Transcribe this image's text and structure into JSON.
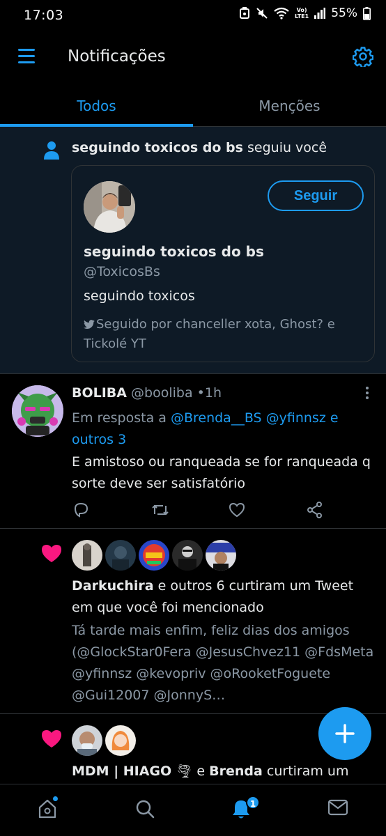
{
  "status_bar": {
    "time": "17:03",
    "network_label_top": "Vo)",
    "network_label_bottom": "LTE1",
    "battery": "55%"
  },
  "header": {
    "title": "Notificações",
    "menu_icon": "hamburger-icon",
    "settings_icon": "gear-icon"
  },
  "tabs": [
    {
      "label": "Todos",
      "active": true
    },
    {
      "label": "Menções",
      "active": false
    }
  ],
  "follow_notification": {
    "name": "seguindo toxicos do bs",
    "action": "seguiu você",
    "card": {
      "name": "seguindo toxicos do bs",
      "handle": "@ToxicosBs",
      "bio": "seguindo toxicos",
      "followed_by": "Seguido por chanceller xota, Ghost? e Tickolé YT",
      "follow_button": "Seguir"
    }
  },
  "tweet": {
    "name": "BOLIBA",
    "handle": "@booliba",
    "separator": "•",
    "time": "1h",
    "reply_prefix": "Em resposta a",
    "reply_mentions": [
      "@Brenda__BS",
      "@yfinnsz"
    ],
    "reply_and": "e",
    "reply_others": "outros 3",
    "text": "E amistoso ou ranqueada se for ranqueada q sorte deve ser satisfatório"
  },
  "like_notification_1": {
    "actor": "Darkuchira",
    "text": "e outros 6 curtiram um Tweet em que você foi mencionado",
    "tweet_text": "Tá tarde mais enfim, feliz dias dos amigos (@GlockStar0Fera  @JesusChvez11 @FdsMeta  @yfinnsz @kevopriv @oRooketFoguete @Gui12007 @JonnyS…"
  },
  "like_notification_2": {
    "actor_1": "MDM | HIAGO",
    "actor_1_emoji": "🌪",
    "and": "e",
    "actor_2": "Brenda",
    "text": "curtiram um"
  },
  "bottom_nav": {
    "notification_badge": "1"
  },
  "colors": {
    "accent": "#1d9bf0",
    "background": "#000000",
    "highlight_background": "#0e1a26",
    "secondary_text": "#8b98a5",
    "like_red": "#f91880"
  }
}
